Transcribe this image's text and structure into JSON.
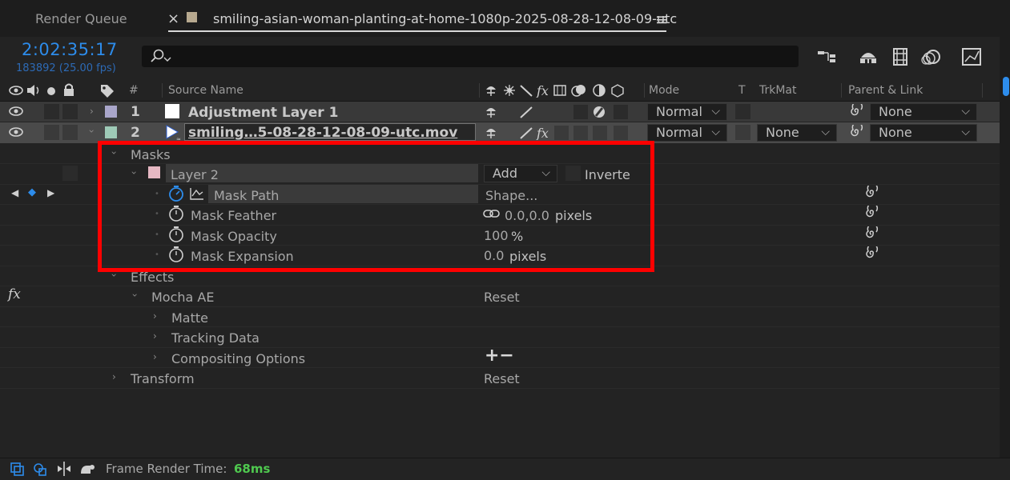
{
  "tabs": {
    "render_queue": "Render Queue",
    "close_glyph": "×",
    "comp_name": "smiling-asian-woman-planting-at-home-1080p-2025-08-28-12-08-09-utc",
    "menu_glyph": "≡"
  },
  "header": {
    "timecode": "2:02:35:17",
    "frames": "183892 (25.00 fps)",
    "search_placeholder": ""
  },
  "columns": {
    "hash": "#",
    "source_name": "Source Name",
    "mode": "Mode",
    "t": "T",
    "trkmat": "TrkMat",
    "parent_link": "Parent & Link"
  },
  "layers": [
    {
      "num": "1",
      "name": "Adjustment Layer 1",
      "mode": "Normal",
      "trkmat": "",
      "parent": "None",
      "label_color": "#a9a6ca"
    },
    {
      "num": "2",
      "name": "smiling…5-08-28-12-08-09-utc.mov",
      "mode": "Normal",
      "trkmat": "None",
      "parent": "None",
      "label_color": "#9ecab7"
    }
  ],
  "masks": {
    "group": "Masks",
    "mask_name": "Layer 2",
    "mask_color": "#e6b8c3",
    "mode": "Add",
    "inverted_label": "Inverte",
    "path_label": "Mask Path",
    "path_value": "Shape...",
    "feather_label": "Mask Feather",
    "feather_value": "0.0,0.0",
    "feather_unit": "pixels",
    "opacity_label": "Mask Opacity",
    "opacity_value": "100",
    "opacity_unit": "%",
    "expansion_label": "Mask Expansion",
    "expansion_value": "0.0",
    "expansion_unit": "pixels"
  },
  "effects": {
    "group": "Effects",
    "fx_glyph": "fx",
    "effect_name": "Mocha AE",
    "effect_reset": "Reset",
    "matte": "Matte",
    "tracking_data": "Tracking Data",
    "compositing_options": "Compositing Options",
    "plus_minus": "+−"
  },
  "transform": {
    "label": "Transform",
    "reset": "Reset"
  },
  "footer": {
    "render_label": "Frame Render Time:",
    "render_value": "68ms"
  },
  "colors": {
    "accent_blue": "#2d8ceb",
    "highlight_red": "#ff0000",
    "render_time_green": "#4fc94f"
  }
}
